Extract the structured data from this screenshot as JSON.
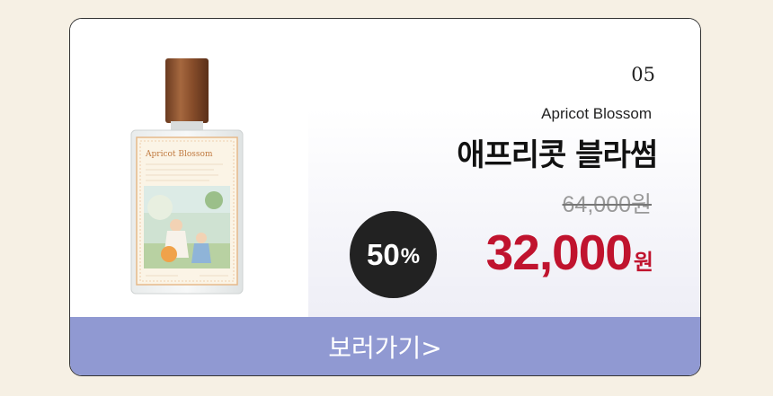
{
  "product": {
    "index": "05",
    "english_name": "Apricot Blossom",
    "korean_name": "애프리콧 블라썸",
    "original_price": "64,000원",
    "discount_percent": "50",
    "discount_unit": "%",
    "sale_price": "32,000",
    "currency_unit": "원",
    "label_text": "Apricot Blossom"
  },
  "cta": {
    "label": "보러가기>"
  },
  "colors": {
    "background": "#f6f0e4",
    "cta_button": "#9099d2",
    "sale_price": "#c0132e",
    "badge": "#222222"
  }
}
